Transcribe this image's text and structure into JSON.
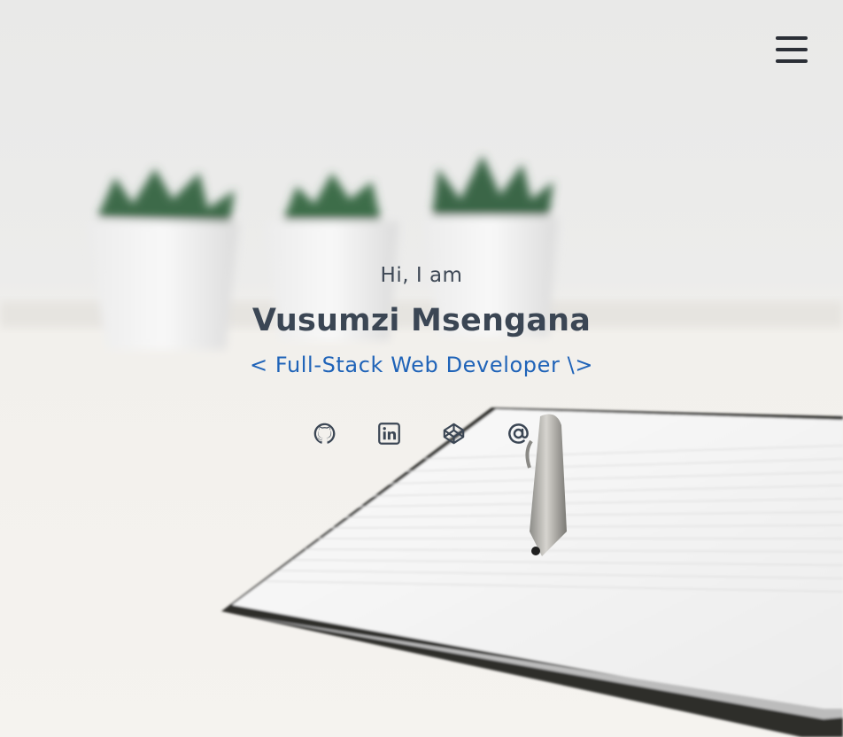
{
  "header": {
    "menu_icon": "hamburger-menu-icon"
  },
  "hero": {
    "greeting": "Hi, I am",
    "name": "Vusumzi Msengana",
    "tagline": "< Full-Stack Web Developer \\>"
  },
  "socials": [
    {
      "icon": "github-icon"
    },
    {
      "icon": "linkedin-icon"
    },
    {
      "icon": "codepen-icon"
    },
    {
      "icon": "email-at-icon"
    }
  ],
  "colors": {
    "text_dark": "#3b4654",
    "accent_blue": "#1f63b8",
    "icon_dark": "#2b2f36"
  }
}
